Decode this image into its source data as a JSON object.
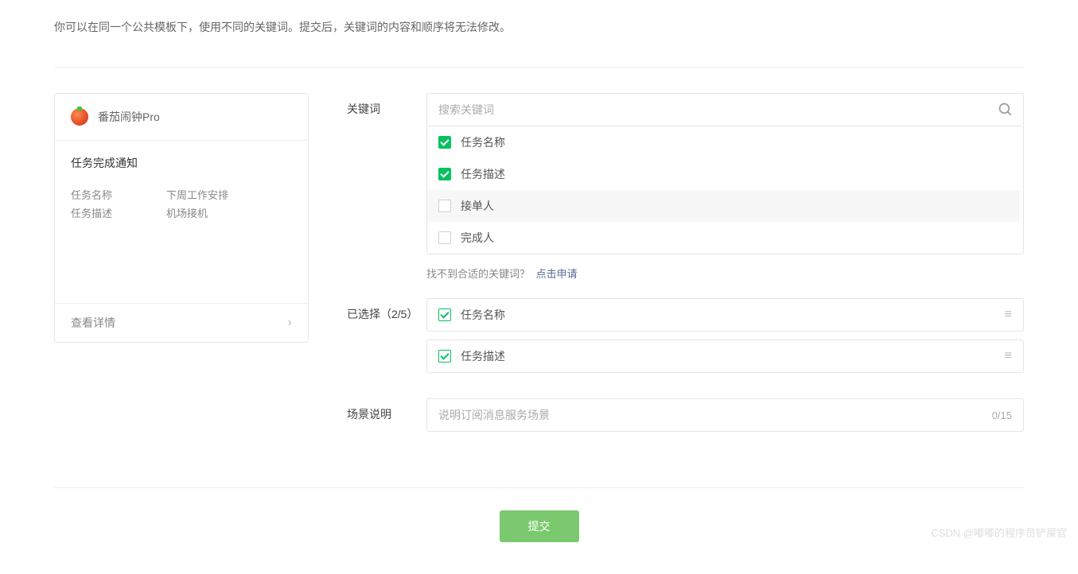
{
  "intro": "你可以在同一个公共模板下，使用不同的关键词。提交后，关键词的内容和顺序将无法修改。",
  "preview": {
    "app_name": "番茄闹钟Pro",
    "title": "任务完成通知",
    "rows": [
      {
        "label": "任务名称",
        "value": "下周工作安排"
      },
      {
        "label": "任务描述",
        "value": "机场接机"
      }
    ],
    "footer_label": "查看详情"
  },
  "labels": {
    "keywords": "关键词",
    "selected": "已选择（2/5）",
    "scene": "场景说明"
  },
  "search": {
    "placeholder": "搜索关键词"
  },
  "keyword_options": [
    {
      "label": "任务名称",
      "checked": true
    },
    {
      "label": "任务描述",
      "checked": true
    },
    {
      "label": "接单人",
      "checked": false,
      "hover": true
    },
    {
      "label": "完成人",
      "checked": false
    }
  ],
  "keyword_hint": {
    "text": "找不到合适的关键词？",
    "link": "点击申请"
  },
  "selected_keywords": [
    {
      "label": "任务名称"
    },
    {
      "label": "任务描述"
    }
  ],
  "scene": {
    "placeholder": "说明订阅消息服务场景",
    "count": "0/15"
  },
  "submit_label": "提交",
  "watermark": "CSDN @嘟嘟的程序员铲屎官"
}
